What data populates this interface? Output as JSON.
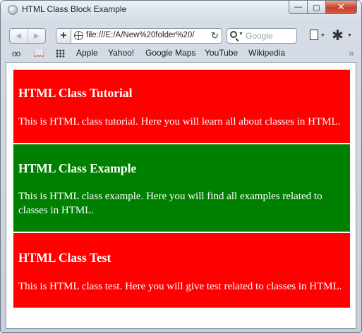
{
  "window": {
    "title": "HTML Class Block Example",
    "minimize_glyph": "—",
    "maximize_glyph": "▢",
    "close_glyph": "✕"
  },
  "toolbar": {
    "back_glyph": "◀",
    "forward_glyph": "▶",
    "add_glyph": "+",
    "address": "file:///E:/A/New%20folder%20/",
    "reload_glyph": "↻",
    "search_placeholder": "Google",
    "search_caret": "▼",
    "menu_caret": "▼",
    "gear_glyph": "✱"
  },
  "bookmarks": {
    "reading_glyph": "oo",
    "book_glyph": "📖",
    "overflow_glyph": "»",
    "items": [
      "Apple",
      "Yahoo!",
      "Google Maps",
      "YouTube",
      "Wikipedia"
    ]
  },
  "content": {
    "blocks": [
      {
        "heading": "HTML Class Tutorial",
        "text": "This is HTML class tutorial. Here you will learn all about classes in HTML.",
        "color": "#ff0000"
      },
      {
        "heading": "HTML Class Example",
        "text": "This is HTML class example. Here you will find all examples related to classes in HTML.",
        "color": "#008000"
      },
      {
        "heading": "HTML Class Test",
        "text": "This is HTML class test. Here you will give test related to classes in HTML.",
        "color": "#ff0000"
      }
    ]
  }
}
